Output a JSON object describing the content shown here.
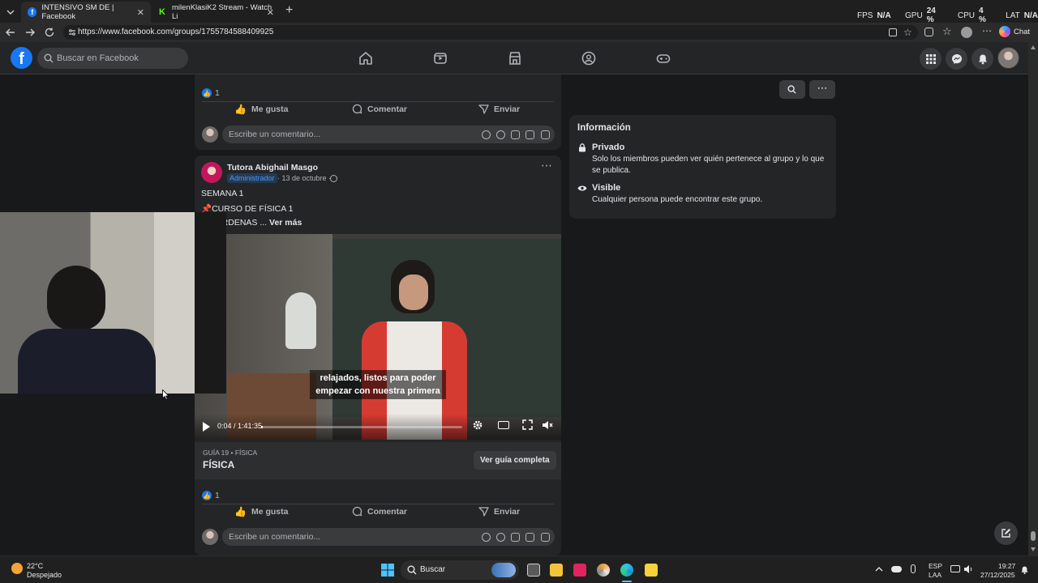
{
  "browser": {
    "tabs": [
      {
        "title": "INTENSIVO SM DE | Facebook",
        "close": "✕"
      },
      {
        "title": "milenKlasiK2 Stream - Watch Li",
        "close": "✕"
      }
    ],
    "new_tab": "+",
    "url": "https://www.facebook.com/groups/1755784588409925",
    "chat_label": "Chat",
    "metrics": [
      {
        "label": "FPS",
        "value": "N/A"
      },
      {
        "label": "GPU",
        "value": "24 %"
      },
      {
        "label": "CPU",
        "value": "4 %"
      },
      {
        "label": "LAT",
        "value": "N/A"
      }
    ]
  },
  "facebook": {
    "logo": "f",
    "search_placeholder": "Buscar en Facebook"
  },
  "post1": {
    "like_count": "1",
    "like_label": "Me gusta",
    "comment_label": "Comentar",
    "send_label": "Enviar",
    "comment_placeholder": "Escribe un comentario..."
  },
  "post2": {
    "author": "Tutora Abighail Masgo",
    "badge": "Administrador",
    "date": "· 13 de octubre ·",
    "line1": "SEMANA 1",
    "line2": "📌CURSO DE FÍSICA 1",
    "line3": "F. CARDENAS ...",
    "see_more": "Ver más",
    "video": {
      "subtitle_line1": "relajados, listos para poder",
      "subtitle_line2": "empezar con nuestra primera",
      "time": "0:04 / 1:41:35",
      "progress": 0.0007
    },
    "guide_meta": "GUÍA 19 • FÍSICA",
    "guide_title": "FÍSICA",
    "guide_button": "Ver guía completa",
    "like_count": "1",
    "like_label": "Me gusta",
    "comment_label": "Comentar",
    "send_label": "Enviar",
    "comment_placeholder": "Escribe un comentario..."
  },
  "info": {
    "title": "Información",
    "private_title": "Privado",
    "private_desc_1": "Solo los miembros pueden ver quién pertenece al grupo y lo que",
    "private_desc_2": "se publica.",
    "visible_title": "Visible",
    "visible_desc": "Cualquier persona puede encontrar este grupo."
  },
  "taskbar": {
    "weather_temp": "22°C",
    "weather_desc": "Despejado",
    "search_label": "Buscar",
    "lang_1": "ESP",
    "lang_2": "LAA",
    "time": "19:27",
    "date": "27/12/2025"
  }
}
